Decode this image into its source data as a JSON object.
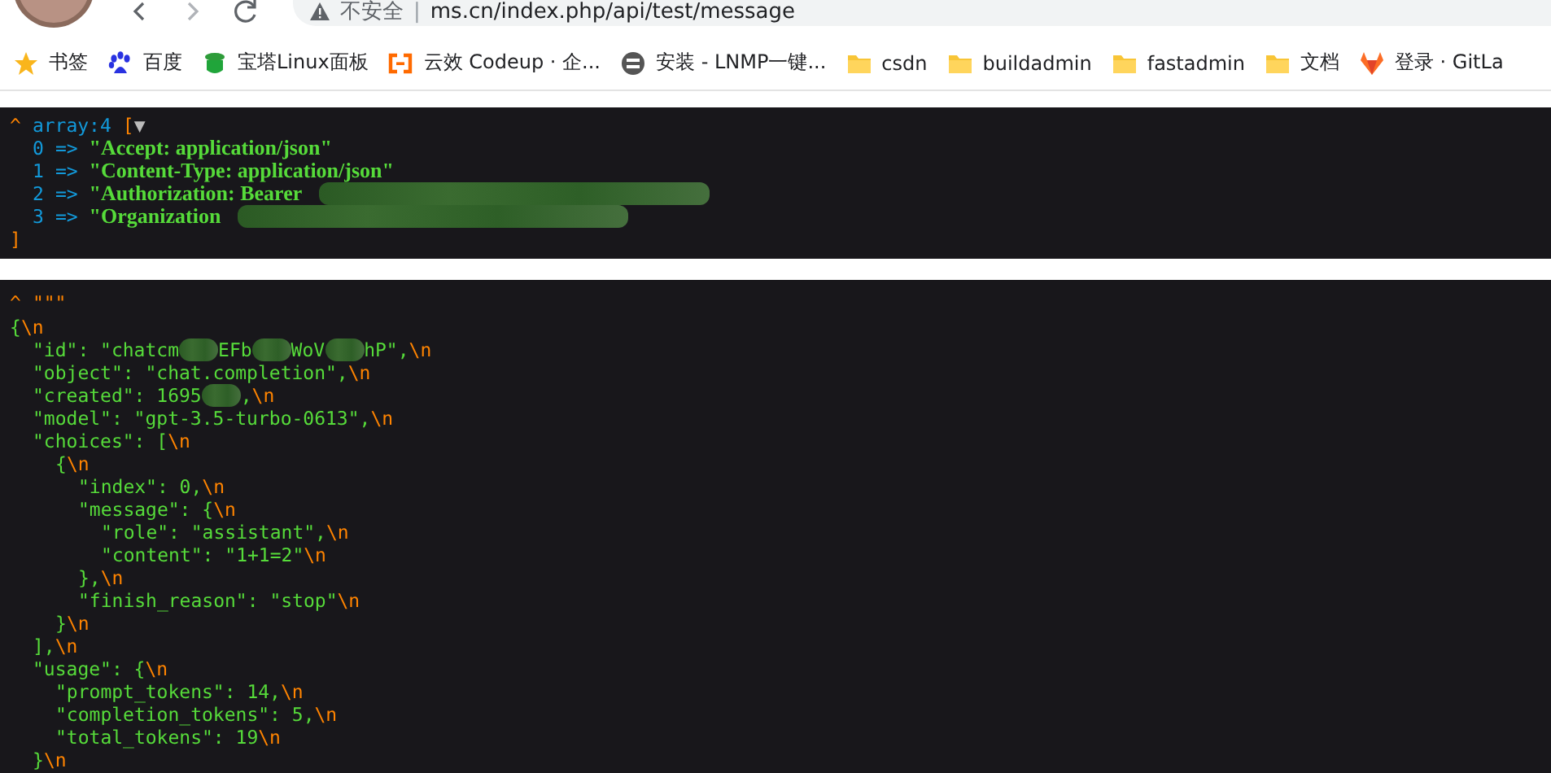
{
  "browser": {
    "security_label": "不安全",
    "separator": "|",
    "url": "ms.cn/index.php/api/test/message"
  },
  "bookmarks": [
    {
      "kind": "bookmark",
      "label": "书签"
    },
    {
      "kind": "site",
      "label": "百度"
    },
    {
      "kind": "site",
      "label": "宝塔Linux面板"
    },
    {
      "kind": "site",
      "label": "云效 Codeup · 企..."
    },
    {
      "kind": "site",
      "label": "安装 - LNMP一键..."
    },
    {
      "kind": "folder",
      "label": "csdn"
    },
    {
      "kind": "folder",
      "label": "buildadmin"
    },
    {
      "kind": "folder",
      "label": "fastadmin"
    },
    {
      "kind": "folder",
      "label": "文档"
    },
    {
      "kind": "site",
      "label": "登录 · GitLa"
    }
  ],
  "dumps": [
    {
      "kind": "array",
      "caret": "^",
      "type": "array:4",
      "open": "[",
      "toggle": "▼",
      "close": "]",
      "items": [
        {
          "index": "0",
          "arrow": "=>",
          "value": "\"Accept: application/json\"",
          "redacted": false
        },
        {
          "index": "1",
          "arrow": "=>",
          "value": "\"Content-Type: application/json\"",
          "redacted": false
        },
        {
          "index": "2",
          "arrow": "=>",
          "value": "\"Authorization: Bearer",
          "redacted": true
        },
        {
          "index": "3",
          "arrow": "=>",
          "value": "\"Organization",
          "redacted": true
        }
      ]
    },
    {
      "kind": "string",
      "caret": "^",
      "quotes": "\"\"\"",
      "lines": [
        [
          {
            "kind": "code",
            "text": "{"
          },
          {
            "kind": "escape",
            "text": "\\n"
          }
        ],
        [
          {
            "kind": "code",
            "text": "\"id\": \"chatcm"
          },
          {
            "kind": "redacted"
          },
          {
            "kind": "code",
            "text": "EFb"
          },
          {
            "kind": "redacted"
          },
          {
            "kind": "code",
            "text": "WoV"
          },
          {
            "kind": "redacted"
          },
          {
            "kind": "code",
            "text": "hP\","
          },
          {
            "kind": "escape",
            "text": "\\n"
          }
        ],
        [
          {
            "kind": "code",
            "text": "\"object\": \"chat.completion\","
          },
          {
            "kind": "escape",
            "text": "\\n"
          }
        ],
        [
          {
            "kind": "code",
            "text": "\"created\": 1695"
          },
          {
            "kind": "redacted"
          },
          {
            "kind": "code",
            "text": ","
          },
          {
            "kind": "escape",
            "text": "\\n"
          }
        ],
        [
          {
            "kind": "code",
            "text": "\"model\": \"gpt-3.5-turbo-0613\","
          },
          {
            "kind": "escape",
            "text": "\\n"
          }
        ],
        [
          {
            "kind": "code",
            "text": "\"choices\": ["
          },
          {
            "kind": "escape",
            "text": "\\n"
          }
        ],
        [
          {
            "kind": "code",
            "text": "{"
          },
          {
            "kind": "escape",
            "text": "\\n"
          }
        ],
        [
          {
            "kind": "code",
            "text": "\"index\": 0,"
          },
          {
            "kind": "escape",
            "text": "\\n"
          }
        ],
        [
          {
            "kind": "code",
            "text": "\"message\": {"
          },
          {
            "kind": "escape",
            "text": "\\n"
          }
        ],
        [
          {
            "kind": "code",
            "text": "\"role\": \"assistant\","
          },
          {
            "kind": "escape",
            "text": "\\n"
          }
        ],
        [
          {
            "kind": "code",
            "text": "\"content\": \"1+1=2\""
          },
          {
            "kind": "escape",
            "text": "\\n"
          }
        ],
        [
          {
            "kind": "code",
            "text": "},"
          },
          {
            "kind": "escape",
            "text": "\\n"
          }
        ],
        [
          {
            "kind": "code",
            "text": "\"finish_reason\": \"stop\""
          },
          {
            "kind": "escape",
            "text": "\\n"
          }
        ],
        [
          {
            "kind": "code",
            "text": "}"
          },
          {
            "kind": "escape",
            "text": "\\n"
          }
        ],
        [
          {
            "kind": "code",
            "text": "],"
          },
          {
            "kind": "escape",
            "text": "\\n"
          }
        ],
        [
          {
            "kind": "code",
            "text": "\"usage\": {"
          },
          {
            "kind": "escape",
            "text": "\\n"
          }
        ],
        [
          {
            "kind": "code",
            "text": "\"prompt_tokens\": 14,"
          },
          {
            "kind": "escape",
            "text": "\\n"
          }
        ],
        [
          {
            "kind": "code",
            "text": "\"completion_tokens\": 5,"
          },
          {
            "kind": "escape",
            "text": "\\n"
          }
        ],
        [
          {
            "kind": "code",
            "text": "\"total_tokens\": 19"
          },
          {
            "kind": "escape",
            "text": "\\n"
          }
        ],
        [
          {
            "kind": "code",
            "text": "}"
          },
          {
            "kind": "escape",
            "text": "\\n"
          }
        ]
      ]
    }
  ]
}
